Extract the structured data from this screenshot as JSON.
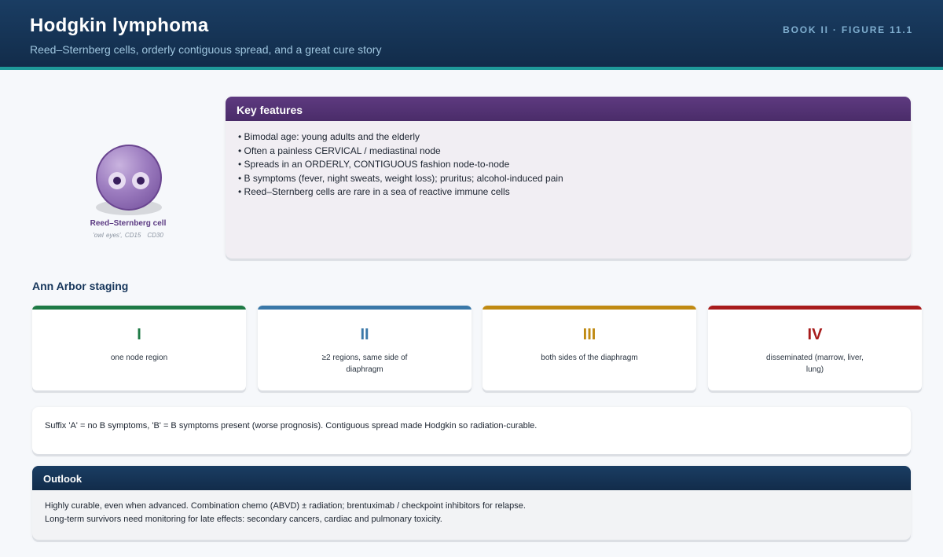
{
  "header": {
    "title": "Hodgkin lymphoma",
    "subtitle": "Reed–Sternberg cells, orderly contiguous spread, and a great cure story",
    "book_ref": "BOOK II · FIGURE 11.1"
  },
  "cell": {
    "label": "Reed–Sternberg cell",
    "markers": [
      "'owl eyes', CD15",
      "CD30"
    ]
  },
  "features": {
    "heading": "Key features",
    "items": [
      "• Bimodal age: young adults and the elderly",
      "• Often a painless CERVICAL / mediastinal node",
      "• Spreads in an ORDERLY, CONTIGUOUS fashion node-to-node",
      "• B symptoms (fever, night sweats, weight loss); pruritus; alcohol-induced pain",
      "• Reed–Sternberg cells are rare in a sea of reactive immune cells"
    ]
  },
  "staging": {
    "title": "Ann Arbor staging",
    "stages": [
      {
        "numeral": "I",
        "description": "one node region",
        "color": "#1e7a45"
      },
      {
        "numeral": "II",
        "description": "≥2 regions, same side of diaphragm",
        "color": "#3a78a8"
      },
      {
        "numeral": "III",
        "description": "both sides of the diaphragm",
        "color": "#c08a12"
      },
      {
        "numeral": "IV",
        "description": "disseminated (marrow, liver, lung)",
        "color": "#a81c1c"
      }
    ]
  },
  "note": "Suffix 'A' = no B symptoms, 'B' = B symptoms present (worse prognosis). Contiguous spread made Hodgkin so radiation-curable.",
  "outlook": {
    "heading": "Outlook",
    "lines": [
      "Highly curable, even when advanced. Combination chemo (ABVD) ± radiation; brentuximab / checkpoint inhibitors for relapse.",
      "Long-term survivors need monitoring for late effects: secondary cancers, cardiac and pulmonary toxicity."
    ]
  },
  "colors": {
    "header_bg": "#1a3d63",
    "accent_teal": "#1f9a9a",
    "features_purple": "#5e3a80"
  }
}
